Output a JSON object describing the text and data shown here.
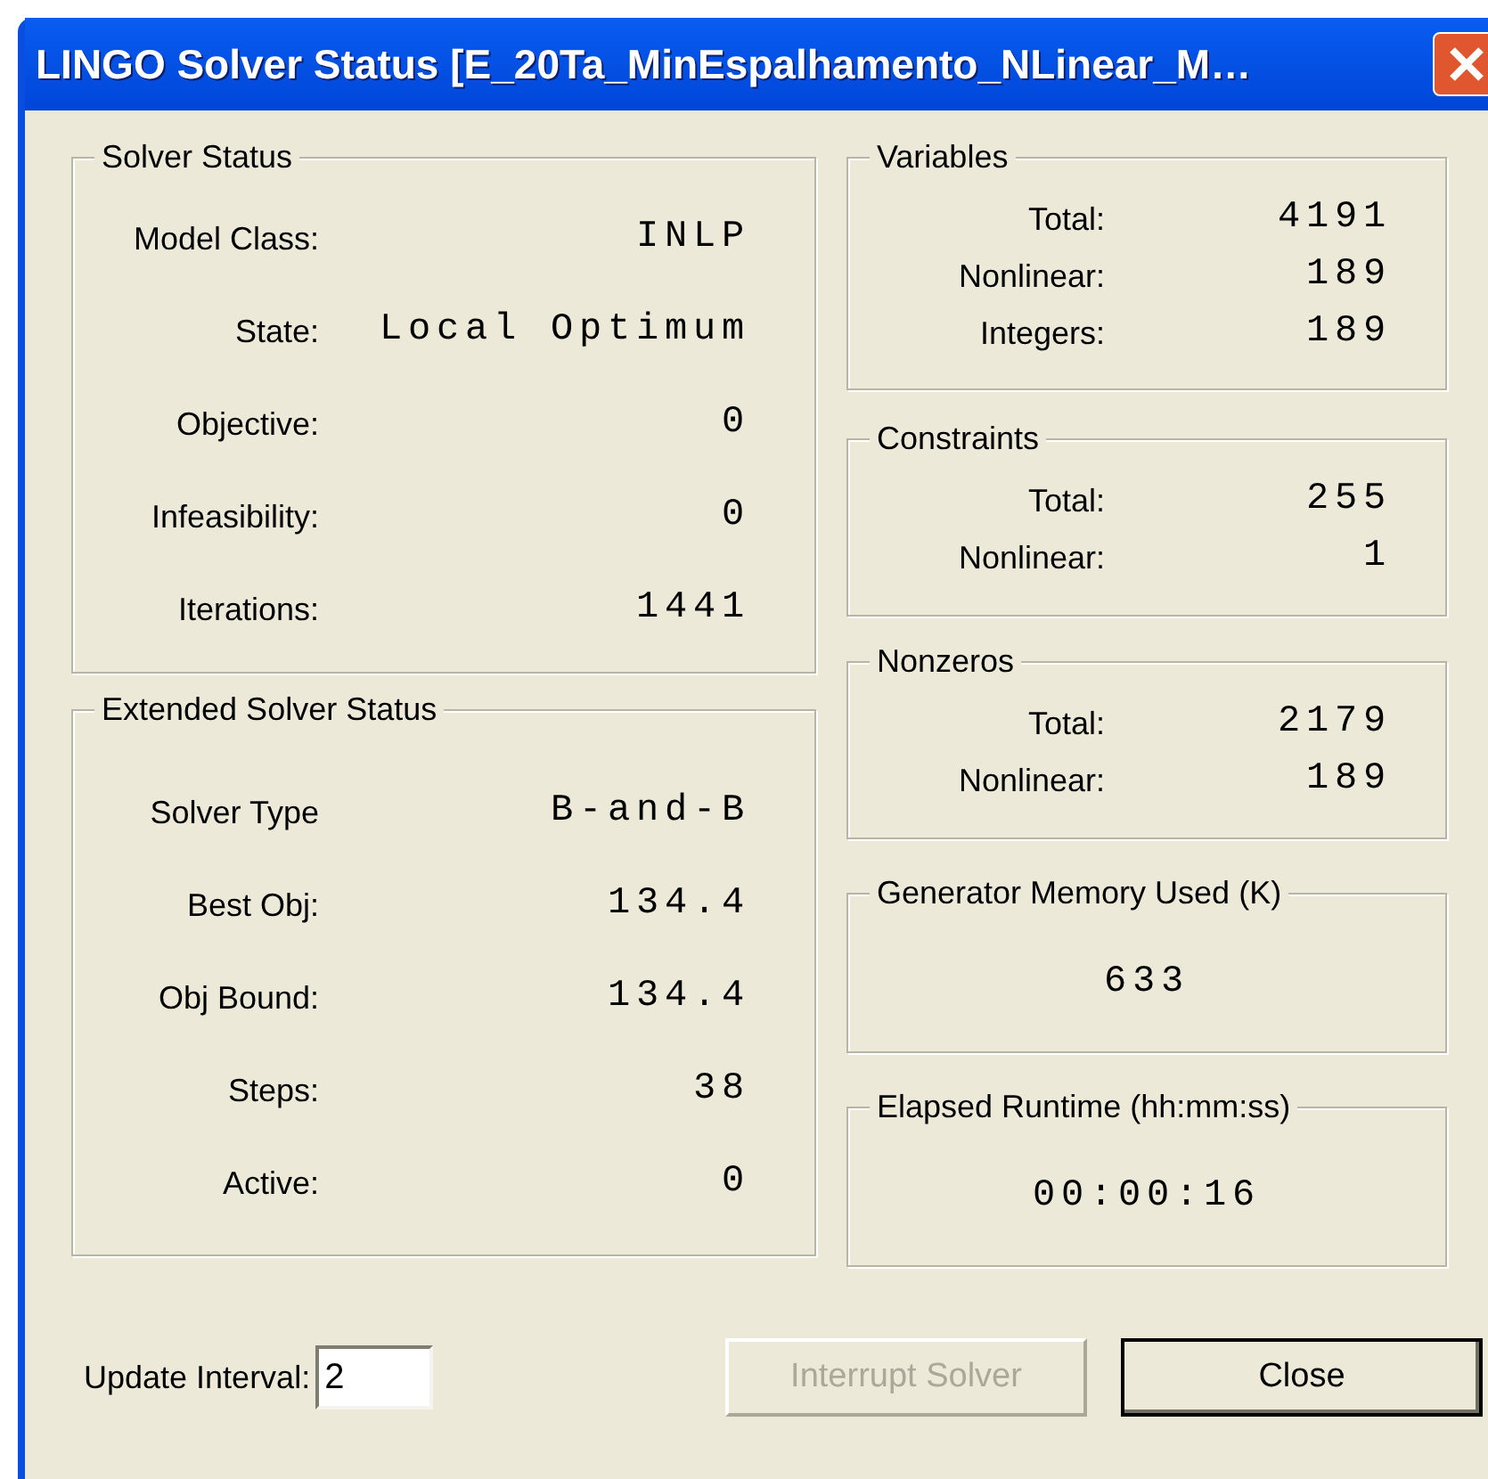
{
  "window": {
    "title": "LINGO Solver Status [E_20Ta_MinEspalhamento_NLinear_M…"
  },
  "left_groups": [
    {
      "title": "Solver Status",
      "rows": [
        {
          "label": "Model Class:",
          "value": "INLP"
        },
        {
          "label": "State:",
          "value": "Local Optimum"
        },
        {
          "label": "Objective:",
          "value": "0"
        },
        {
          "label": "Infeasibility:",
          "value": "0"
        },
        {
          "label": "Iterations:",
          "value": "1441"
        }
      ]
    },
    {
      "title": "Extended Solver Status",
      "rows": [
        {
          "label": "Solver Type",
          "value": "B-and-B"
        },
        {
          "label": "Best Obj:",
          "value": "134.4"
        },
        {
          "label": "Obj Bound:",
          "value": "134.4"
        },
        {
          "label": "Steps:",
          "value": "38"
        },
        {
          "label": "Active:",
          "value": "0"
        }
      ]
    }
  ],
  "right_groups": [
    {
      "kind": "rows",
      "title": "Variables",
      "rows": [
        {
          "label": "Total:",
          "value": "4191"
        },
        {
          "label": "Nonlinear:",
          "value": "189"
        },
        {
          "label": "Integers:",
          "value": "189"
        }
      ]
    },
    {
      "kind": "rows",
      "title": "Constraints",
      "rows": [
        {
          "label": "Total:",
          "value": "255"
        },
        {
          "label": "Nonlinear:",
          "value": "1"
        }
      ]
    },
    {
      "kind": "rows",
      "title": "Nonzeros",
      "rows": [
        {
          "label": "Total:",
          "value": "2179"
        },
        {
          "label": "Nonlinear:",
          "value": "189"
        }
      ]
    },
    {
      "kind": "single",
      "title": "Generator Memory Used (K)",
      "value": "633"
    },
    {
      "kind": "single",
      "title": "Elapsed Runtime (hh:mm:ss)",
      "value": "00:00:16"
    }
  ],
  "update_interval": {
    "label": "Update Interval:",
    "value": "2"
  },
  "buttons": [
    {
      "label": "Interrupt Solver",
      "disabled": true
    },
    {
      "label": "Close",
      "disabled": false
    }
  ]
}
